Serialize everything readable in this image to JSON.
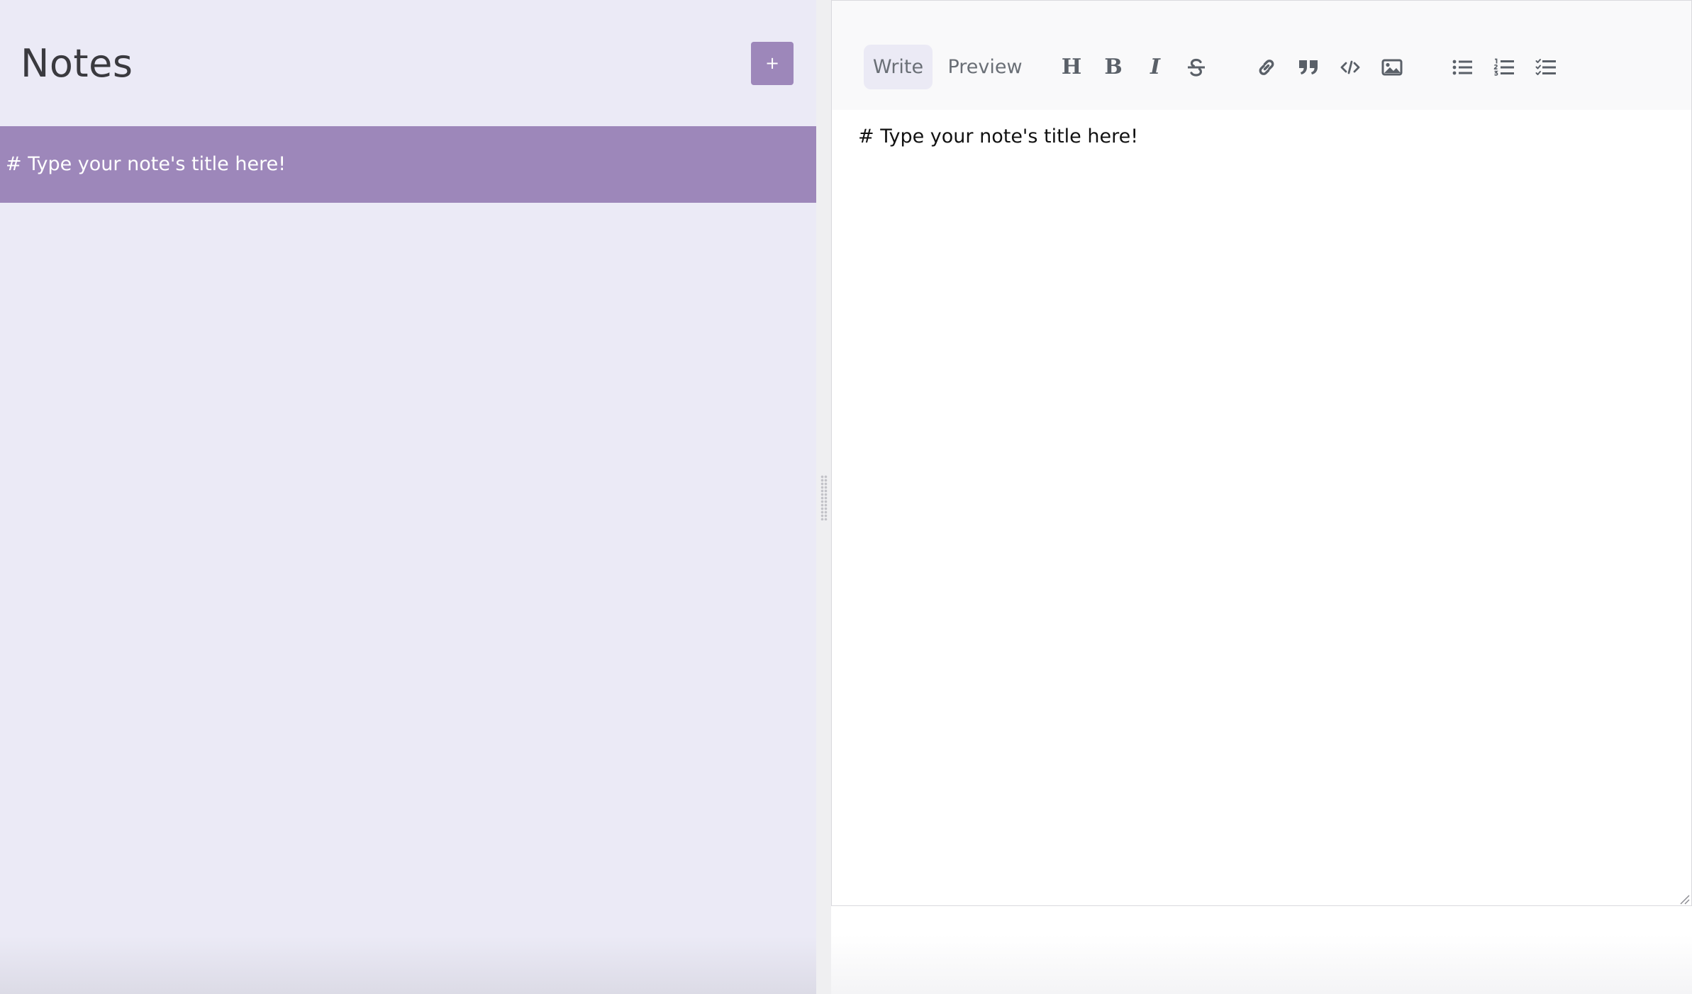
{
  "sidebar": {
    "title": "Notes",
    "add_button_label": "+",
    "notes": [
      {
        "title": "# Type your note's title here!",
        "selected": true
      }
    ]
  },
  "editor": {
    "tabs": [
      {
        "label": "Write",
        "active": true
      },
      {
        "label": "Preview",
        "active": false
      }
    ],
    "toolbar": {
      "groups": [
        [
          "header-icon",
          "bold-icon",
          "italic-icon",
          "strikethrough-icon"
        ],
        [
          "link-icon",
          "quote-icon",
          "code-icon",
          "image-icon"
        ],
        [
          "unordered-list-icon",
          "ordered-list-icon",
          "checked-list-icon"
        ]
      ],
      "header_glyph": "H",
      "bold_glyph": "B",
      "italic_glyph": "I"
    },
    "content": "# Type your note's title here!"
  },
  "colors": {
    "accent": "#9d87ba",
    "sidebar_bg": "#ebeaf6",
    "active_tab_bg": "#ebeaf5",
    "toolbar_bg": "#f9f9fa",
    "icon": "#5a6068",
    "title_text": "#3a3a3f"
  }
}
